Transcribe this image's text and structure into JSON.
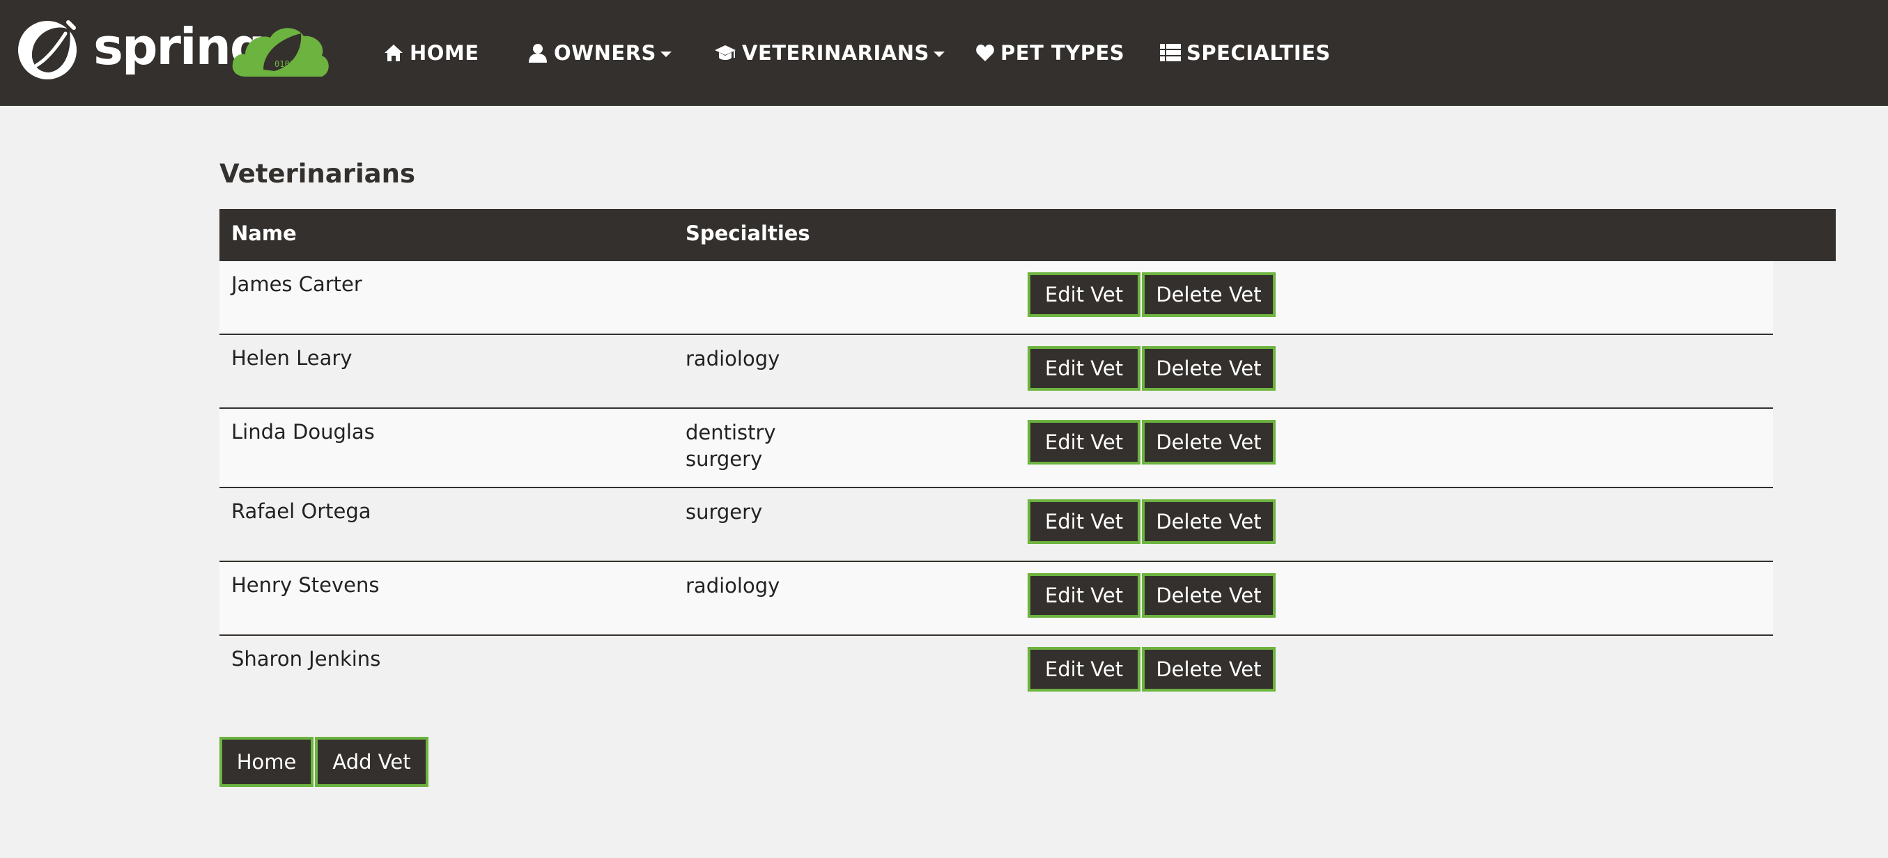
{
  "navbar": {
    "brand_name": "spring",
    "items": [
      {
        "label": "HOME",
        "icon": "home-icon",
        "dropdown": false
      },
      {
        "label": "OWNERS",
        "icon": "user-icon",
        "dropdown": true
      },
      {
        "label": "VETERINARIANS",
        "icon": "graduation-cap-icon",
        "dropdown": true
      },
      {
        "label": "PET TYPES",
        "icon": "heart-icon",
        "dropdown": false
      },
      {
        "label": "SPECIALTIES",
        "icon": "list-icon",
        "dropdown": false
      }
    ]
  },
  "page": {
    "title": "Veterinarians"
  },
  "table": {
    "headers": {
      "name": "Name",
      "specialties": "Specialties"
    },
    "rows": [
      {
        "name": "James Carter",
        "specialties": [],
        "edit_label": "Edit Vet",
        "delete_label": "Delete Vet"
      },
      {
        "name": "Helen Leary",
        "specialties": [
          "radiology"
        ],
        "edit_label": "Edit Vet",
        "delete_label": "Delete Vet"
      },
      {
        "name": "Linda Douglas",
        "specialties": [
          "dentistry",
          "surgery"
        ],
        "edit_label": "Edit Vet",
        "delete_label": "Delete Vet"
      },
      {
        "name": "Rafael Ortega",
        "specialties": [
          "surgery"
        ],
        "edit_label": "Edit Vet",
        "delete_label": "Delete Vet"
      },
      {
        "name": "Henry Stevens",
        "specialties": [
          "radiology"
        ],
        "edit_label": "Edit Vet",
        "delete_label": "Delete Vet"
      },
      {
        "name": "Sharon Jenkins",
        "specialties": [],
        "edit_label": "Edit Vet",
        "delete_label": "Delete Vet"
      }
    ]
  },
  "bottom_actions": {
    "home_label": "Home",
    "add_label": "Add Vet"
  },
  "colors": {
    "navbar_bg": "#34302d",
    "page_bg": "#f1f1f1",
    "accent_green": "#6db33f"
  }
}
